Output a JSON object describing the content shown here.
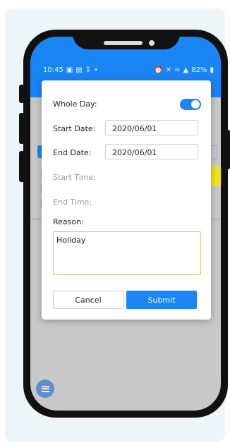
{
  "status_bar": {
    "time": "10:45",
    "battery": "82%"
  },
  "dialog": {
    "whole_day_label": "Whole Day:",
    "whole_day_on": true,
    "start_date_label": "Start Date:",
    "start_date_value": "2020/06/01",
    "end_date_label": "End Date:",
    "end_date_value": "2020/06/01",
    "start_time_label": "Start Time:",
    "end_time_label": "End Time:",
    "reason_label": "Reason:",
    "reason_value": "Holiday",
    "cancel_label": "Cancel",
    "submit_label": "Submit"
  },
  "icons": [
    "gallery-icon",
    "sim-icon",
    "download-icon",
    "dot-icon",
    "alarm-icon",
    "mute-icon",
    "wifi-icon",
    "signal-icon",
    "battery-icon",
    "menu-icon"
  ],
  "colors": {
    "accent": "#1a85f5",
    "banner": "#f2e21a",
    "card_bg": "#eef5f9"
  }
}
